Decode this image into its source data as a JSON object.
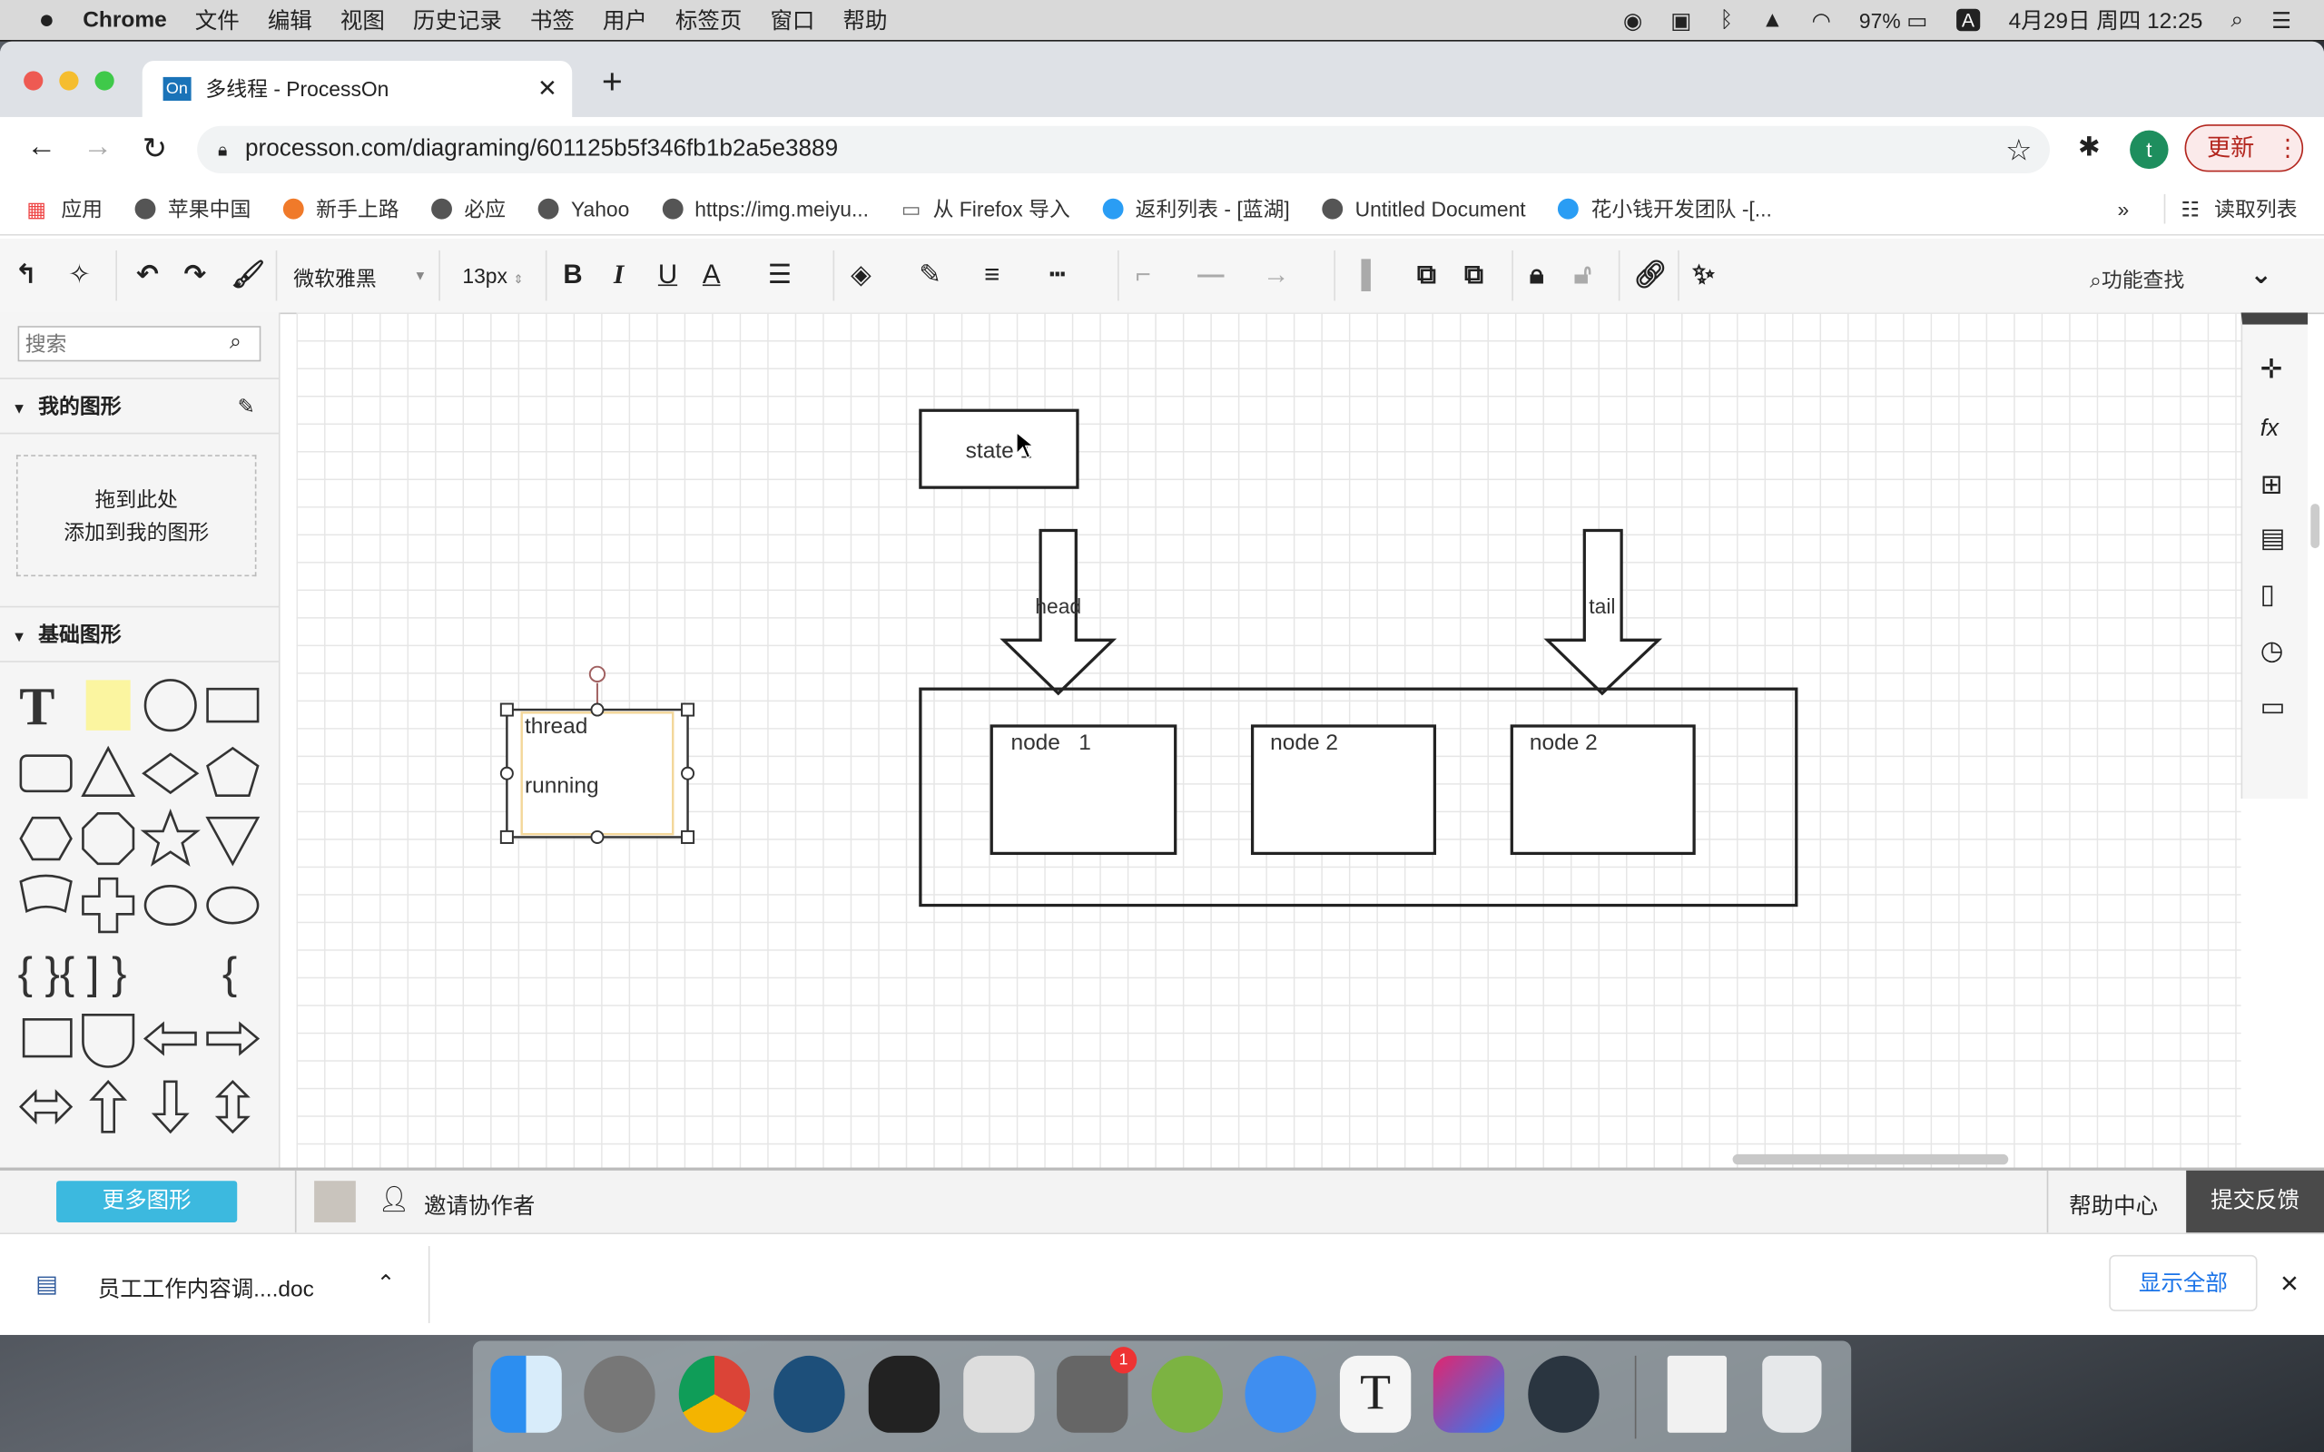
{
  "menubar": {
    "app": "Chrome",
    "items": [
      "文件",
      "编辑",
      "视图",
      "历史记录",
      "书签",
      "用户",
      "标签页",
      "窗口",
      "帮助"
    ],
    "battery": "97%",
    "input": "A",
    "datetime": "4月29日 周四 12:25"
  },
  "browser": {
    "tab_title": "多线程 - ProcessOn",
    "tab_favicon": "On",
    "url": "processon.com/diagraming/601125b5f346fb1b2a5e3889",
    "profile_initial": "t",
    "update_label": "更新",
    "bookmarks": [
      "应用",
      "苹果中国",
      "新手上路",
      "必应",
      "Yahoo",
      "https://img.meiyu...",
      "从 Firefox 导入",
      "返利列表 - [蓝湖]",
      "Untitled Document",
      "花小钱开发团队 -[..."
    ],
    "more_bookmarks": "»",
    "reading_list": "读取列表"
  },
  "toolbar": {
    "font": "微软雅黑",
    "font_size": "13px",
    "search_feature": "功能查找"
  },
  "sidebar": {
    "search_placeholder": "搜索",
    "my_shapes": "我的图形",
    "drop_hint_1": "拖到此处",
    "drop_hint_2": "添加到我的图形",
    "basic_shapes": "基础图形",
    "more_shapes": "更多图形"
  },
  "diagram": {
    "state": "state 1",
    "head": "head",
    "tail": "tail",
    "nodes": [
      "node   1",
      "node 2",
      "node 2"
    ],
    "thread_line1": "thread",
    "thread_line2": "running"
  },
  "bottombar": {
    "invite": "邀请协作者",
    "help": "帮助中心",
    "feedback": "提交反馈"
  },
  "downloads": {
    "file": "员工工作内容调....doc",
    "show_all": "显示全部"
  },
  "colors": {
    "more_shapes_btn": "#3cb9df",
    "update_btn": "#b3261e",
    "profile": "#1e8e5e",
    "feedback_bg": "#4a4a4a"
  }
}
